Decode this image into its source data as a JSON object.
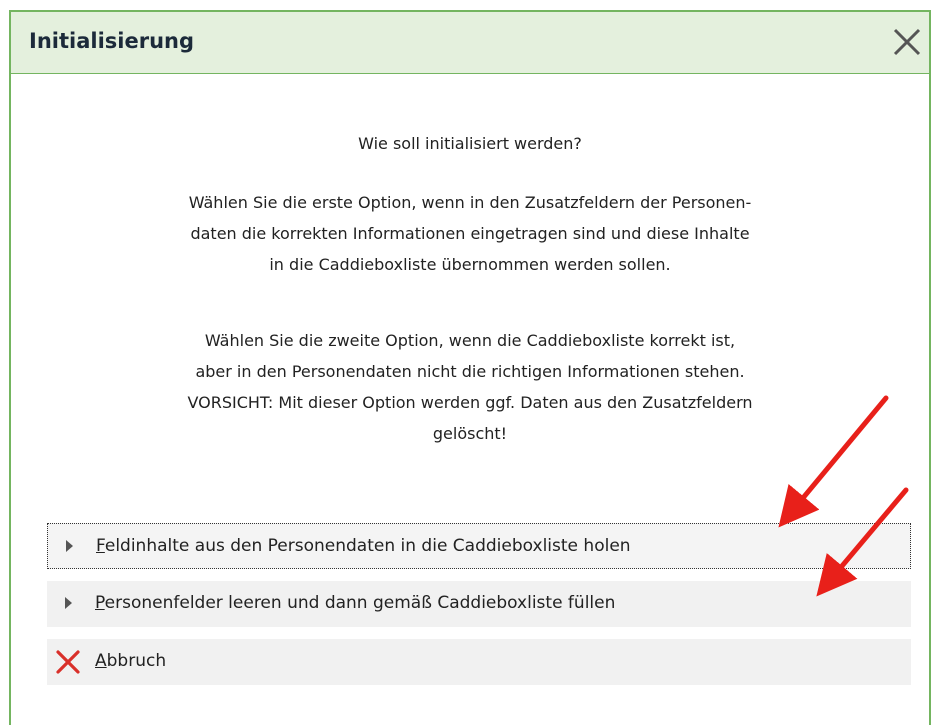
{
  "dialog": {
    "title": "Initialisierung",
    "question": "Wie soll initialisiert werden?",
    "paragraph1_lines": [
      "Wählen Sie die erste Option, wenn in den Zusatzfeldern der Personen-",
      "daten die korrekten Informationen eingetragen sind und diese Inhalte",
      "in die Caddieboxliste übernommen werden sollen."
    ],
    "paragraph2_lines": [
      "Wählen Sie die zweite Option, wenn die Caddieboxliste korrekt ist,",
      "aber in den Personendaten nicht die richtigen Informationen stehen.",
      "VORSICHT: Mit dieser Option werden ggf. Daten aus den Zusatzfeldern",
      "gelöscht!"
    ]
  },
  "options": [
    {
      "mnemonic": "F",
      "rest": "eldinhalte aus den Personendaten in die Caddieboxliste holen",
      "icon": "play-triangle-icon"
    },
    {
      "mnemonic": "P",
      "rest": "ersonenfelder leeren und dann gemäß Caddieboxliste füllen",
      "icon": "play-triangle-icon"
    },
    {
      "mnemonic": "A",
      "rest": "bbruch",
      "icon": "red-x-icon"
    }
  ],
  "colors": {
    "titlebar_bg": "#e4f0dd",
    "border": "#74b560",
    "annotation_arrow": "#e8201a",
    "cancel_icon": "#d9302a"
  }
}
